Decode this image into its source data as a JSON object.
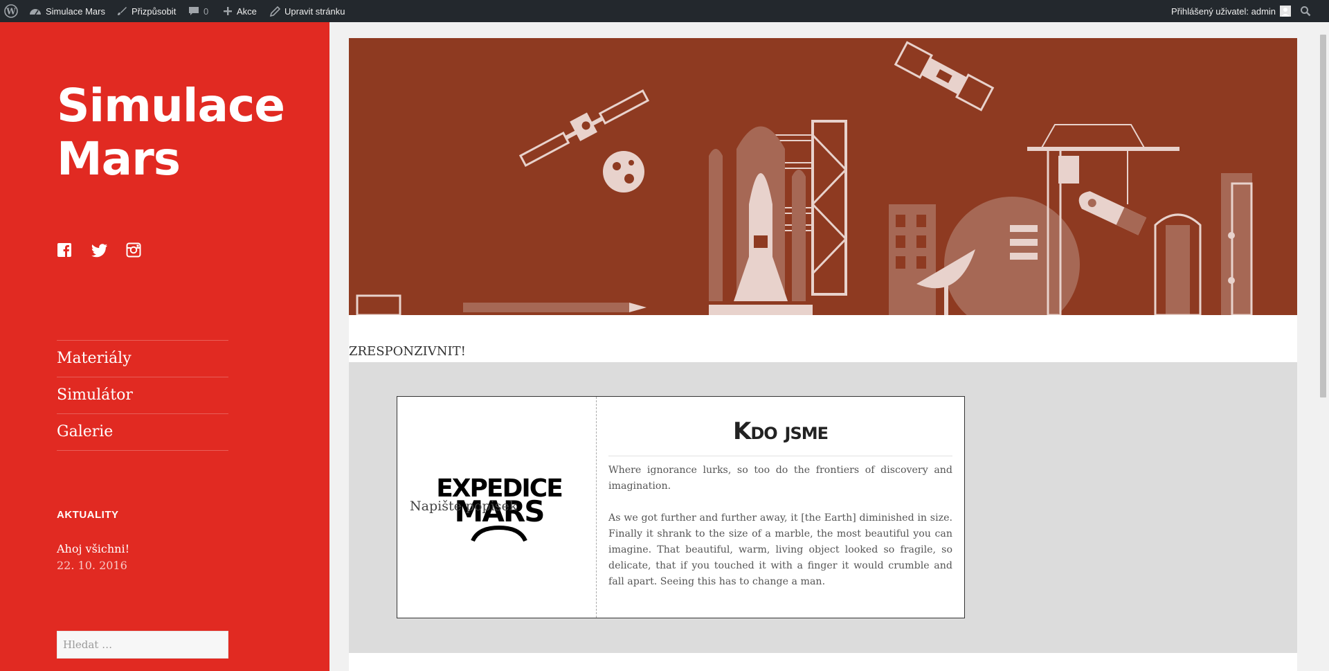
{
  "adminbar": {
    "site_name": "Simulace Mars",
    "customize": "Přizpůsobit",
    "comments_count": "0",
    "new": "Akce",
    "edit_page": "Upravit stránku",
    "user_greeting": "Přihlášený uživatel: admin"
  },
  "sidebar": {
    "site_title_line1": "Simulace",
    "site_title_line2": "Mars",
    "social_icons": [
      "facebook-icon",
      "twitter-icon",
      "instagram-icon"
    ],
    "menu": [
      {
        "label": "Materiály"
      },
      {
        "label": "Simulátor"
      },
      {
        "label": "Galerie"
      }
    ],
    "widget_title": "AKTUALITY",
    "recent_post": {
      "title": "Ahoj všichni!",
      "date": "22. 10. 2016"
    },
    "search_placeholder": "Hledat …"
  },
  "main": {
    "post_title": "ZRESPONZIVNIT!",
    "card": {
      "logo_text_line1": "EXPEDICE",
      "logo_text_line2": "MARS",
      "caption": "Napište popisek",
      "heading": "Kdo jsme",
      "paragraph1": "Where ignorance lurks, so too do the frontiers of discovery and imagination.",
      "paragraph2": "As we got further and further away, it [the Earth] diminished in size. Finally it shrank to the size of a marble, the most beautiful you can imagine. That beautiful, warm, living object looked so fragile, so delicate, that if you touched it with a finger it would crumble and fall apart. Seeing this has to change a man."
    }
  },
  "colors": {
    "sidebar_bg": "#e12a22",
    "header_bg": "#8e3a21",
    "illustration": "#e8d2cc",
    "adminbar_bg": "#23282d"
  }
}
